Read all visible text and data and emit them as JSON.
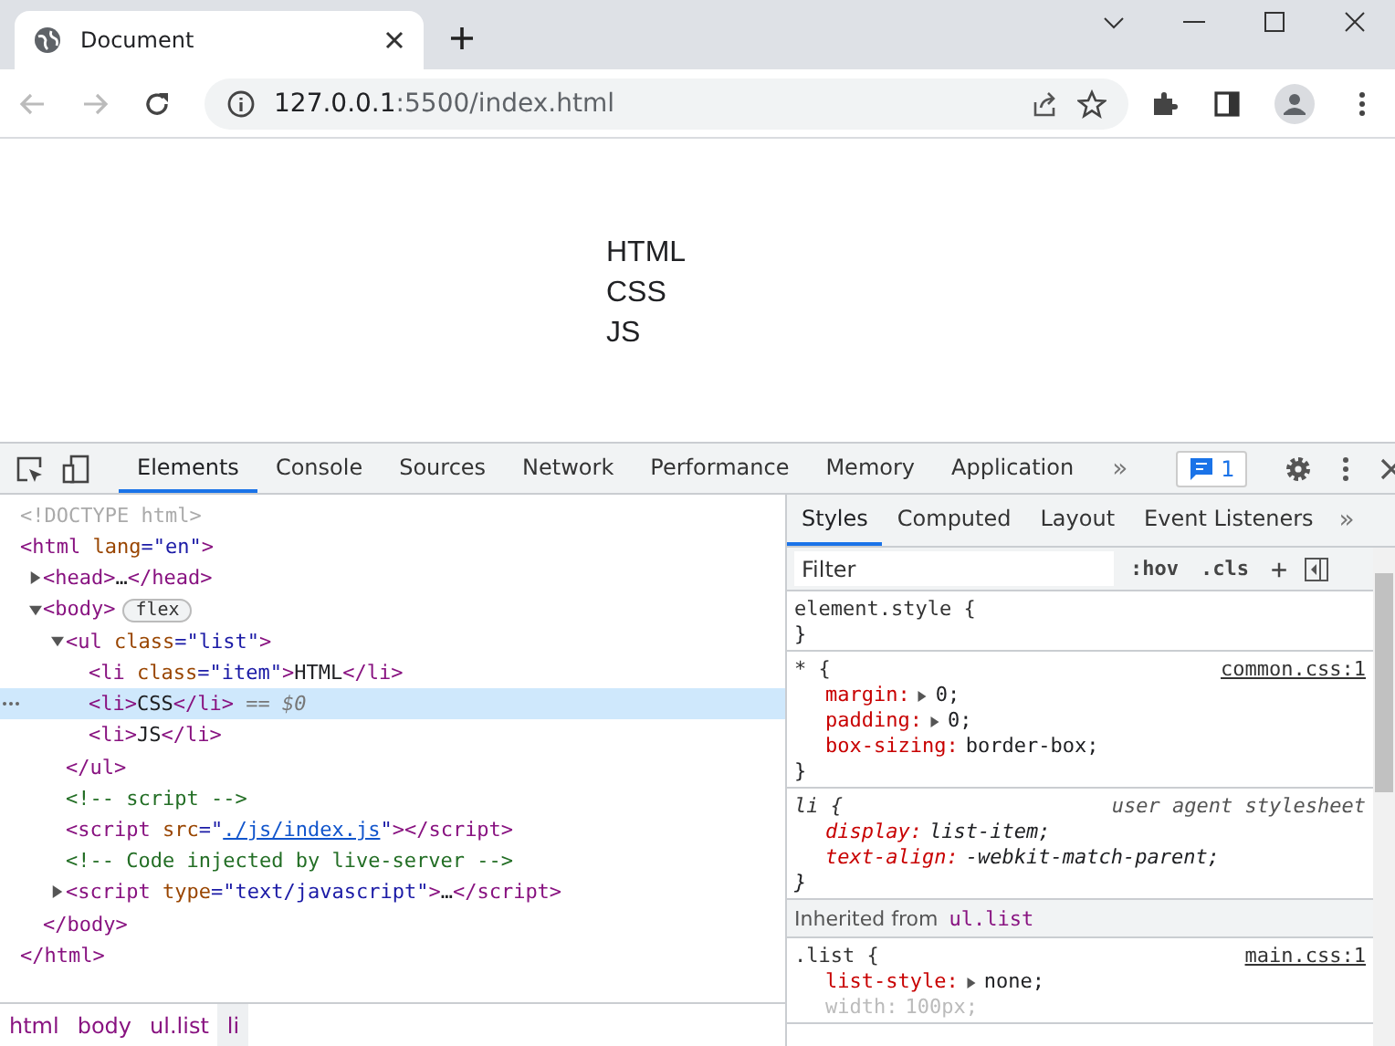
{
  "browser": {
    "tab_title": "Document",
    "url_host": "127.0.0.1",
    "url_path": ":5500/index.html"
  },
  "page": {
    "items": [
      "HTML",
      "CSS",
      "JS"
    ]
  },
  "devtools": {
    "tabs": [
      {
        "label": "Elements",
        "selected": true
      },
      {
        "label": "Console",
        "selected": false
      },
      {
        "label": "Sources",
        "selected": false
      },
      {
        "label": "Network",
        "selected": false
      },
      {
        "label": "Performance",
        "selected": false
      },
      {
        "label": "Memory",
        "selected": false
      },
      {
        "label": "Application",
        "selected": false
      }
    ],
    "more": "»",
    "issues_count": "1"
  },
  "dom": {
    "nodes": [
      {
        "selected": false,
        "parts": [
          {
            "kind": "doctype",
            "text": "<!DOCTYPE html>"
          }
        ]
      },
      {
        "selected": false,
        "parts": [
          {
            "kind": "tag",
            "text": "<html"
          },
          {
            "kind": "attr",
            "text": " lang"
          },
          {
            "kind": "value",
            "text": "=\"en\""
          },
          {
            "kind": "tag",
            "text": ">"
          }
        ],
        "closing": [
          {
            "kind": "tag",
            "text": "</html>"
          }
        ],
        "children": [
          {
            "selected": false,
            "expanded": false,
            "parts": [
              {
                "kind": "tag",
                "text": "<head>"
              },
              {
                "kind": "text",
                "text": "…"
              },
              {
                "kind": "tag",
                "text": "</head>"
              }
            ]
          },
          {
            "selected": false,
            "expanded": true,
            "parts": [
              {
                "kind": "tag",
                "text": "<body>"
              },
              {
                "kind": "badge",
                "text": "flex"
              }
            ],
            "closing": [
              {
                "kind": "tag",
                "text": "</body>"
              }
            ],
            "children": [
              {
                "selected": false,
                "expanded": true,
                "parts": [
                  {
                    "kind": "tag",
                    "text": "<ul"
                  },
                  {
                    "kind": "attr",
                    "text": " class"
                  },
                  {
                    "kind": "value",
                    "text": "=\"list\""
                  },
                  {
                    "kind": "tag",
                    "text": ">"
                  }
                ],
                "closing": [
                  {
                    "kind": "tag",
                    "text": "</ul>"
                  }
                ],
                "children": [
                  {
                    "selected": false,
                    "parts": [
                      {
                        "kind": "tag",
                        "text": "<li"
                      },
                      {
                        "kind": "attr",
                        "text": " class"
                      },
                      {
                        "kind": "value",
                        "text": "=\"item\""
                      },
                      {
                        "kind": "tag",
                        "text": ">"
                      },
                      {
                        "kind": "text",
                        "text": "HTML"
                      },
                      {
                        "kind": "tag",
                        "text": "</li>"
                      }
                    ]
                  },
                  {
                    "selected": true,
                    "parts": [
                      {
                        "kind": "tag",
                        "text": "<li>"
                      },
                      {
                        "kind": "text",
                        "text": "CSS"
                      },
                      {
                        "kind": "tag",
                        "text": "</li>"
                      },
                      {
                        "kind": "marker",
                        "text": " == $0"
                      }
                    ]
                  },
                  {
                    "selected": false,
                    "parts": [
                      {
                        "kind": "tag",
                        "text": "<li>"
                      },
                      {
                        "kind": "text",
                        "text": "JS"
                      },
                      {
                        "kind": "tag",
                        "text": "</li>"
                      }
                    ]
                  }
                ]
              },
              {
                "selected": false,
                "parts": [
                  {
                    "kind": "comment",
                    "text": "<!-- script -->"
                  }
                ]
              },
              {
                "selected": false,
                "parts": [
                  {
                    "kind": "tag",
                    "text": "<script"
                  },
                  {
                    "kind": "attr",
                    "text": " src"
                  },
                  {
                    "kind": "value",
                    "text": "=\""
                  },
                  {
                    "kind": "link",
                    "text": "./js/index.js"
                  },
                  {
                    "kind": "value",
                    "text": "\""
                  },
                  {
                    "kind": "tag",
                    "text": "></script>"
                  }
                ]
              },
              {
                "selected": false,
                "parts": [
                  {
                    "kind": "comment",
                    "text": "<!-- Code injected by live-server -->"
                  }
                ]
              },
              {
                "selected": false,
                "expanded": false,
                "parts": [
                  {
                    "kind": "tag",
                    "text": "<script"
                  },
                  {
                    "kind": "attr",
                    "text": " type"
                  },
                  {
                    "kind": "value",
                    "text": "=\"text/javascript\""
                  },
                  {
                    "kind": "tag",
                    "text": ">"
                  },
                  {
                    "kind": "text",
                    "text": "…"
                  },
                  {
                    "kind": "tag",
                    "text": "</script>"
                  }
                ]
              }
            ]
          }
        ]
      }
    ]
  },
  "breadcrumbs": [
    {
      "label": "html",
      "selected": false
    },
    {
      "label": "body",
      "selected": false
    },
    {
      "label": "ul.list",
      "selected": false
    },
    {
      "label": "li",
      "selected": true
    }
  ],
  "styles": {
    "tabs": [
      {
        "label": "Styles",
        "selected": true
      },
      {
        "label": "Computed",
        "selected": false
      },
      {
        "label": "Layout",
        "selected": false
      },
      {
        "label": "Event Listeners",
        "selected": false
      }
    ],
    "more": "»",
    "filter_placeholder": "Filter",
    "hov": ":hov",
    "cls": ".cls",
    "plus": "+",
    "sections": [
      {
        "kind": "rule",
        "selector": "element.style {",
        "close": "}"
      },
      {
        "kind": "rule",
        "selector": "* {",
        "source": "common.css:1",
        "close": "}",
        "declarations": [
          {
            "property": "margin:",
            "value": "0;",
            "expandable": true,
            "dimmed": false
          },
          {
            "property": "padding:",
            "value": "0;",
            "expandable": true,
            "dimmed": false
          },
          {
            "property": "box-sizing:",
            "value": "border-box;",
            "expandable": false,
            "dimmed": false
          }
        ]
      },
      {
        "kind": "user-agent",
        "selector": "li {",
        "source": "user agent stylesheet",
        "close": "}",
        "declarations": [
          {
            "property": "display:",
            "value": "list-item;",
            "expandable": false,
            "dimmed": false
          },
          {
            "property": "text-align:",
            "value": "-webkit-match-parent;",
            "expandable": false,
            "dimmed": false
          }
        ]
      },
      {
        "kind": "inherited",
        "label": "Inherited from",
        "selector": "ul.list"
      },
      {
        "kind": "rule",
        "selector": ".list {",
        "source": "main.css:1",
        "declarations": [
          {
            "property": "list-style:",
            "value": "none;",
            "expandable": true,
            "dimmed": false
          },
          {
            "property": "width:",
            "value": "100px;",
            "expandable": false,
            "dimmed": true
          }
        ]
      }
    ]
  }
}
